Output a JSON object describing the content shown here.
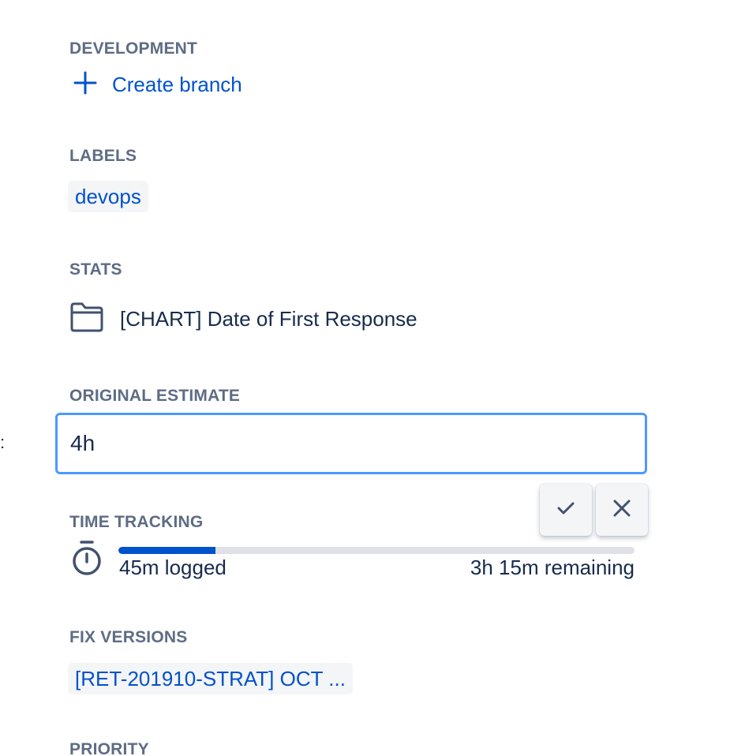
{
  "development": {
    "label": "DEVELOPMENT",
    "create_branch_label": "Create branch"
  },
  "labels": {
    "label": "LABELS",
    "items": [
      "devops"
    ]
  },
  "stats": {
    "label": "STATS",
    "item": "[CHART] Date of First Response"
  },
  "original_estimate": {
    "label": "ORIGINAL ESTIMATE",
    "value": "4h"
  },
  "time_tracking": {
    "label": "TIME TRACKING",
    "logged": "45m logged",
    "remaining": "3h 15m remaining",
    "progress_fraction": 0.1875
  },
  "fix_versions": {
    "label": "FIX VERSIONS",
    "items": [
      "[RET-201910-STRAT] OCT ..."
    ]
  },
  "priority": {
    "label": "PRIORITY"
  },
  "colors": {
    "accent": "#0052cc",
    "focus": "#4c9aff",
    "label": "#5e6c84",
    "text": "#172b4d"
  }
}
